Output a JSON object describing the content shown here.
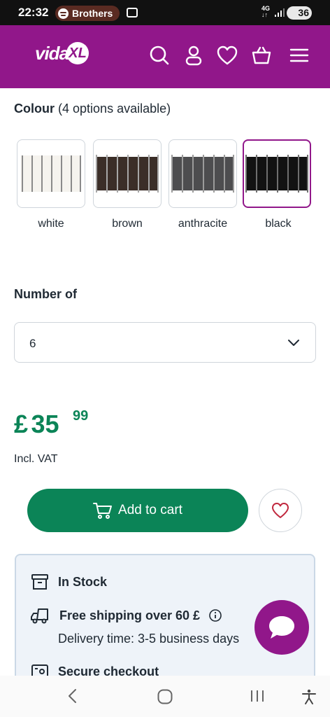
{
  "status_bar": {
    "time": "22:32",
    "media_label": "Brothers",
    "network": "4G",
    "battery": "36"
  },
  "header": {
    "logo_text": "vida",
    "logo_badge": "XL",
    "icons": [
      "search-icon",
      "account-icon",
      "wishlist-heart-icon",
      "basket-icon",
      "menu-icon"
    ],
    "brand_color": "#91178a"
  },
  "colour": {
    "heading": "Colour",
    "options_note": "(4 options available)",
    "options": [
      {
        "label": "white",
        "swatch_color": "#f3f1ec"
      },
      {
        "label": "brown",
        "swatch_color": "#3b2e28"
      },
      {
        "label": "anthracite",
        "swatch_color": "#4d4d4f"
      },
      {
        "label": "black",
        "swatch_color": "#121212"
      }
    ],
    "selected": "black"
  },
  "number_of": {
    "label": "Number of",
    "selected_value": "6"
  },
  "price": {
    "currency": "£",
    "whole": "35",
    "cents": "99",
    "vat_note": "Incl. VAT",
    "color": "#0b8457"
  },
  "actions": {
    "add_to_cart_label": "Add to cart"
  },
  "info": {
    "in_stock": "In Stock",
    "free_shipping": "Free shipping over 60 £",
    "delivery_time": "Delivery time: 3-5 business days",
    "secure_checkout": "Secure checkout"
  }
}
